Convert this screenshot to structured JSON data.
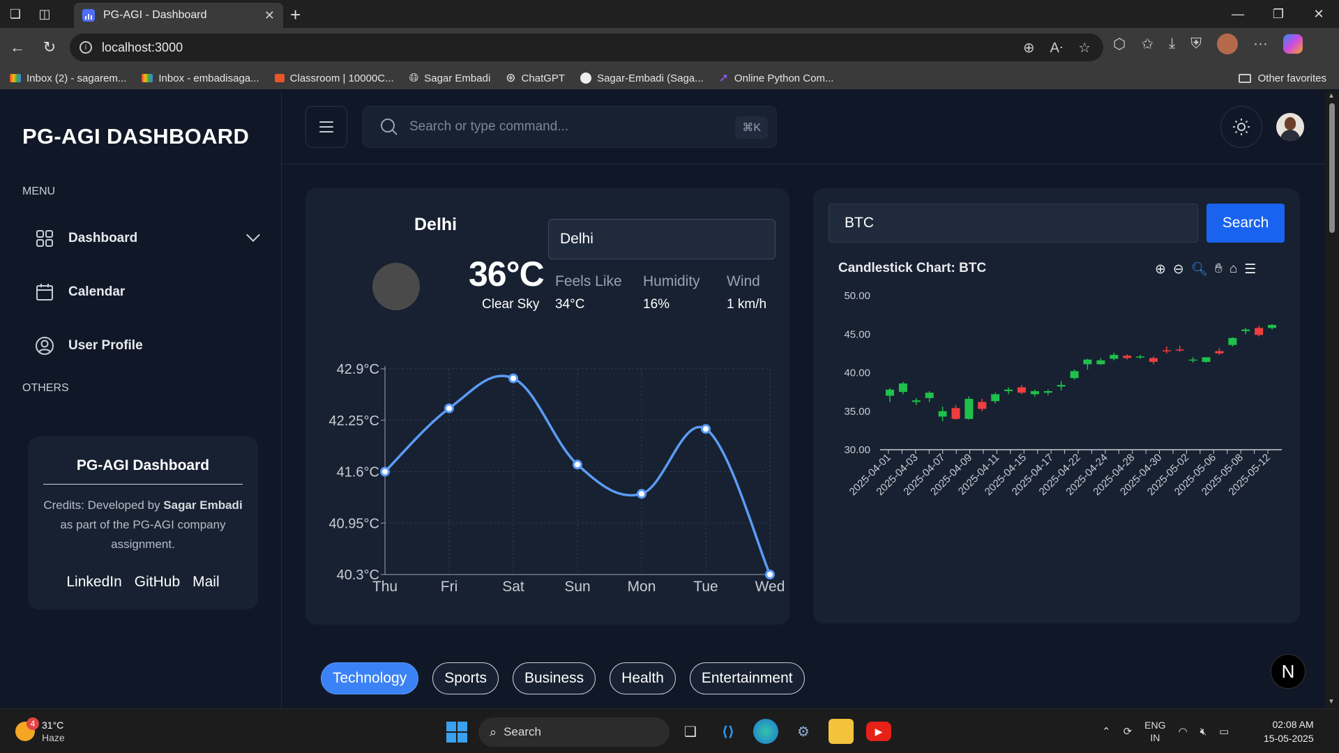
{
  "browser": {
    "tab_title": "PG-AGI - Dashboard",
    "url": "localhost:3000",
    "favorites": [
      "Inbox (2) - sagarem...",
      "Inbox - embadisaga...",
      "Classroom | 10000C...",
      "Sagar Embadi",
      "ChatGPT",
      "Sagar-Embadi (Saga...",
      "Online Python Com..."
    ],
    "other_favorites": "Other favorites"
  },
  "sidebar": {
    "brand": "PG-AGI DASHBOARD",
    "menu_heading": "MENU",
    "items": [
      {
        "label": "Dashboard",
        "icon": "grid-icon"
      },
      {
        "label": "Calendar",
        "icon": "calendar-icon"
      },
      {
        "label": "User Profile",
        "icon": "user-circle-icon"
      }
    ],
    "others_heading": "OTHERS",
    "credits": {
      "title": "PG-AGI Dashboard",
      "text_prefix": "Credits: Developed by ",
      "author": "Sagar Embadi",
      "text_suffix": " as part of the PG-AGI company assignment.",
      "links": [
        "LinkedIn",
        "GitHub",
        "Mail"
      ]
    }
  },
  "header": {
    "search_placeholder": "Search or type command...",
    "shortcut": "⌘K"
  },
  "weather": {
    "city": "Delhi",
    "input_value": "Delhi",
    "temperature": "36°C",
    "condition": "Clear Sky",
    "stats": [
      {
        "label": "Feels Like",
        "value": "34°C"
      },
      {
        "label": "Humidity",
        "value": "16%"
      },
      {
        "label": "Wind",
        "value": "1 km/h"
      }
    ]
  },
  "chart_data": [
    {
      "type": "line",
      "categories": [
        "Thu",
        "Fri",
        "Sat",
        "Sun",
        "Mon",
        "Tue",
        "Wed"
      ],
      "series": [
        {
          "values": [
            41.6,
            42.4,
            42.78,
            41.69,
            41.32,
            42.14,
            40.3
          ]
        }
      ],
      "y_tick_labels": [
        "42.9°C",
        "42.25°C",
        "41.6°C",
        "40.95°C",
        "40.3°C"
      ],
      "ylim": [
        40.3,
        42.9
      ],
      "grid": true,
      "line_color": "#5b9cf6"
    },
    {
      "type": "candlestick",
      "title": "Candlestick Chart: BTC",
      "x_tick_labels": [
        "2025-04-01",
        "2025-04-03",
        "2025-04-07",
        "2025-04-09",
        "2025-04-11",
        "2025-04-15",
        "2025-04-17",
        "2025-04-22",
        "2025-04-24",
        "2025-04-28",
        "2025-04-30",
        "2025-05-02",
        "2025-05-06",
        "2025-05-08",
        "2025-05-12"
      ],
      "y_tick_labels": [
        "50.00",
        "45.00",
        "40.00",
        "35.00",
        "30.00"
      ],
      "ylim": [
        30,
        50
      ],
      "up_color": "#1fc04b",
      "down_color": "#ef3e3e",
      "candles": [
        {
          "o": 37.0,
          "h": 38.0,
          "l": 36.2,
          "c": 37.8
        },
        {
          "o": 37.5,
          "h": 38.8,
          "l": 37.2,
          "c": 38.6
        },
        {
          "o": 36.2,
          "h": 36.7,
          "l": 35.8,
          "c": 36.4
        },
        {
          "o": 36.7,
          "h": 37.6,
          "l": 36.2,
          "c": 37.4
        },
        {
          "o": 34.3,
          "h": 35.6,
          "l": 33.7,
          "c": 35.0
        },
        {
          "o": 35.4,
          "h": 35.8,
          "l": 33.9,
          "c": 34.0
        },
        {
          "o": 34.0,
          "h": 36.9,
          "l": 33.9,
          "c": 36.6
        },
        {
          "o": 36.2,
          "h": 36.6,
          "l": 35.0,
          "c": 35.3
        },
        {
          "o": 36.3,
          "h": 37.4,
          "l": 36.0,
          "c": 37.2
        },
        {
          "o": 37.6,
          "h": 38.1,
          "l": 37.2,
          "c": 37.8
        },
        {
          "o": 38.1,
          "h": 38.4,
          "l": 37.2,
          "c": 37.4
        },
        {
          "o": 37.2,
          "h": 37.8,
          "l": 36.9,
          "c": 37.6
        },
        {
          "o": 37.4,
          "h": 37.8,
          "l": 37.1,
          "c": 37.6
        },
        {
          "o": 38.2,
          "h": 38.9,
          "l": 37.7,
          "c": 38.4
        },
        {
          "o": 39.3,
          "h": 40.4,
          "l": 39.1,
          "c": 40.2
        },
        {
          "o": 41.1,
          "h": 41.8,
          "l": 40.4,
          "c": 41.7
        },
        {
          "o": 41.1,
          "h": 41.9,
          "l": 41.0,
          "c": 41.6
        },
        {
          "o": 41.8,
          "h": 42.6,
          "l": 41.6,
          "c": 42.3
        },
        {
          "o": 42.2,
          "h": 42.4,
          "l": 41.7,
          "c": 41.9
        },
        {
          "o": 42.0,
          "h": 42.3,
          "l": 41.8,
          "c": 42.1
        },
        {
          "o": 41.9,
          "h": 42.1,
          "l": 41.1,
          "c": 41.4
        },
        {
          "o": 42.9,
          "h": 43.4,
          "l": 42.5,
          "c": 42.8
        },
        {
          "o": 43.0,
          "h": 43.5,
          "l": 42.7,
          "c": 42.9
        },
        {
          "o": 41.6,
          "h": 42.0,
          "l": 41.3,
          "c": 41.7
        },
        {
          "o": 41.4,
          "h": 42.0,
          "l": 41.3,
          "c": 42.0
        },
        {
          "o": 42.8,
          "h": 43.2,
          "l": 42.3,
          "c": 42.5
        },
        {
          "o": 43.6,
          "h": 44.6,
          "l": 43.4,
          "c": 44.5
        },
        {
          "o": 45.4,
          "h": 45.8,
          "l": 45.0,
          "c": 45.6
        },
        {
          "o": 45.8,
          "h": 46.1,
          "l": 44.7,
          "c": 44.9
        },
        {
          "o": 45.8,
          "h": 46.3,
          "l": 45.6,
          "c": 46.2
        }
      ]
    }
  ],
  "stock": {
    "input_value": "BTC",
    "button_label": "Search"
  },
  "news_tabs": [
    "Technology",
    "Sports",
    "Business",
    "Health",
    "Entertainment"
  ],
  "fab_label": "N",
  "taskbar": {
    "weather_temp": "31°C",
    "weather_desc": "Haze",
    "badge": "4",
    "search_label": "Search",
    "lang_top": "ENG",
    "lang_bottom": "IN",
    "time": "02:08 AM",
    "date": "15-05-2025"
  }
}
